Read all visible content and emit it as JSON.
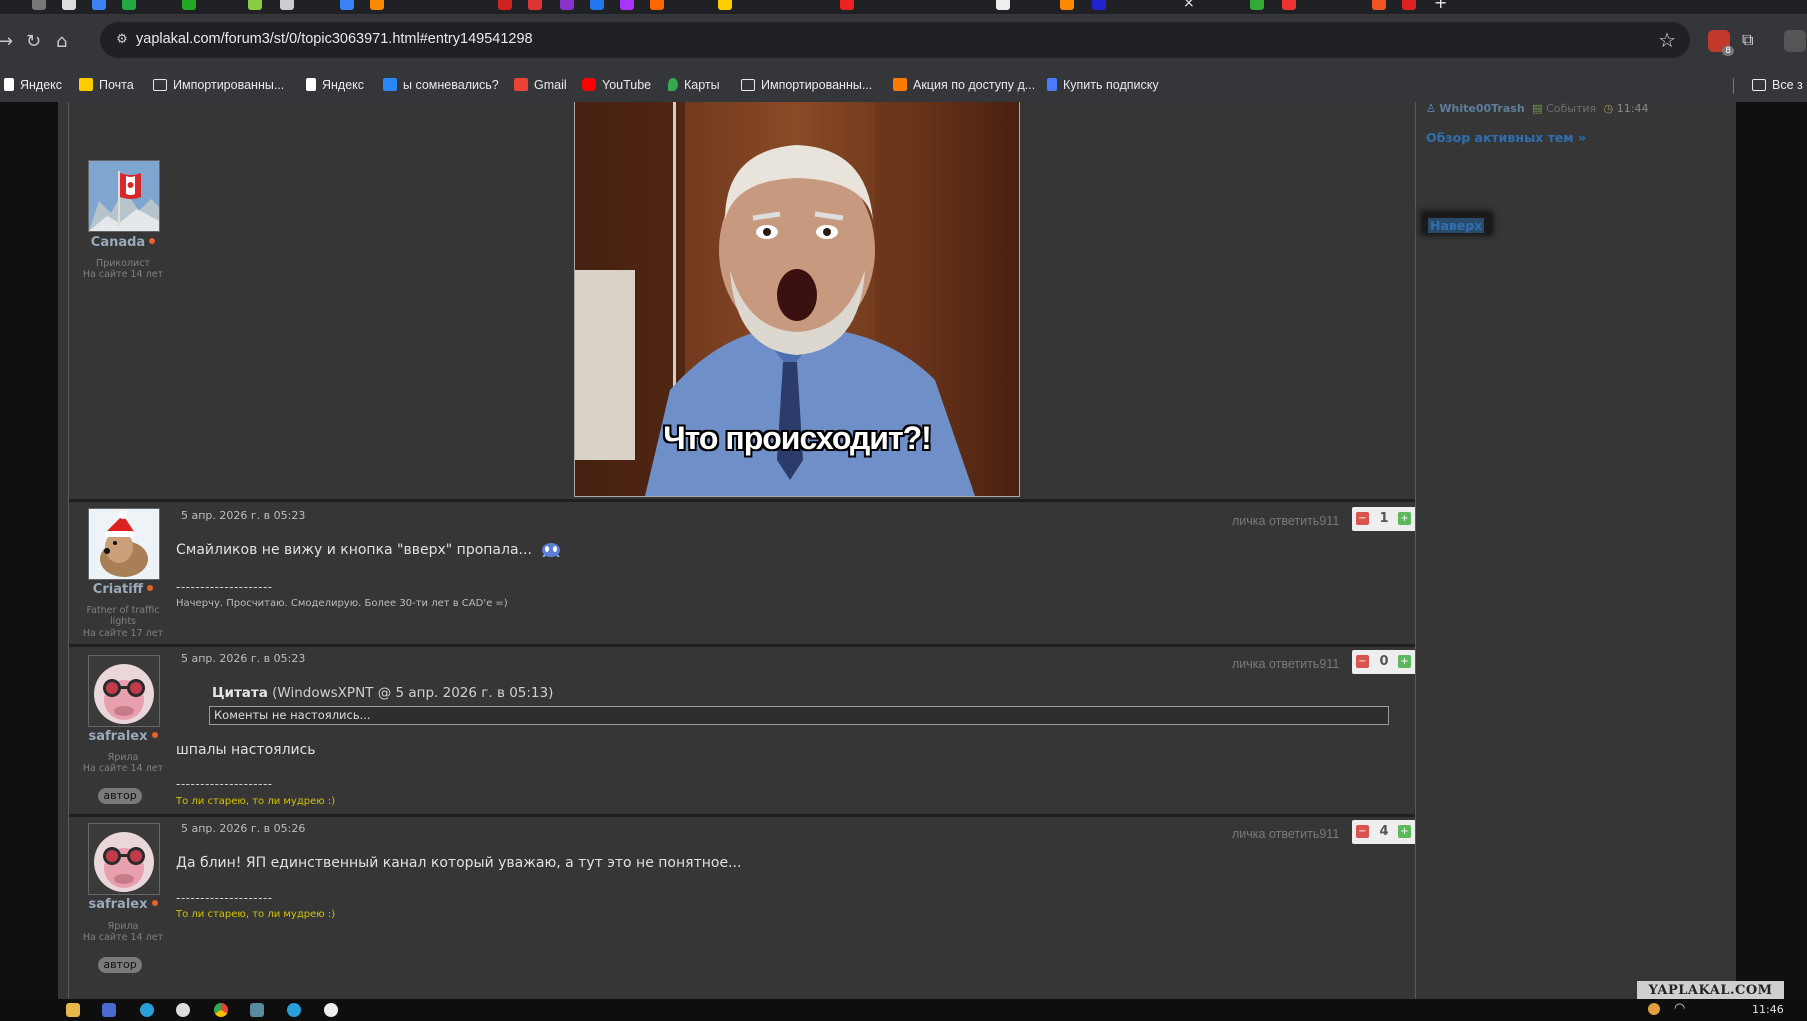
{
  "browser": {
    "url": "yaplakal.com/forum3/st/0/topic3063971.html#entry149541298",
    "extension_badge": "8",
    "bookmarks": [
      {
        "label": "Яндекс",
        "icon": "yandex-icon",
        "color": "#ffffff"
      },
      {
        "label": "Почта",
        "icon": "mail-icon",
        "color": "#ffcc00"
      },
      {
        "label": "Импортированны...",
        "icon": "folder-icon",
        "color": "#e8eaed"
      },
      {
        "label": "Яндекс",
        "icon": "yandex-icon",
        "color": "#ffffff"
      },
      {
        "label": "ы сомневались?",
        "icon": "vk-icon",
        "color": "#2787f5"
      },
      {
        "label": "Gmail",
        "icon": "gmail-icon",
        "color": "#ea4335"
      },
      {
        "label": "YouTube",
        "icon": "youtube-icon",
        "color": "#ff0000"
      },
      {
        "label": "Карты",
        "icon": "maps-icon",
        "color": "#34a853"
      },
      {
        "label": "Импортированны...",
        "icon": "folder-icon",
        "color": "#e8eaed"
      },
      {
        "label": "Акция по доступу д...",
        "icon": "promo-icon",
        "color": "#ff7a00"
      },
      {
        "label": "Купить подписку",
        "icon": "subscription-icon",
        "color": "#4a7bff"
      }
    ],
    "bookmarks_overflow": "Все з"
  },
  "sidebar": {
    "active_user": "White00Trash",
    "events_label": "События",
    "time": "11:44",
    "active_topics_link": "Обзор активных тем »",
    "top_button": "Наверх"
  },
  "first_post": {
    "user": "Canada",
    "rank": "Приколист",
    "tenure": "На сайте 14 лет",
    "image_caption": "Что происходит?!"
  },
  "posts": [
    {
      "user": "Criatiff",
      "rank": "Father of traffic lights",
      "tenure": "На сайте 17 лет",
      "date": "5 апр. 2026 г. в 05:23",
      "actions": "личка ответить911",
      "rating": "1",
      "text": "Смайликов не вижу и кнопка \"вверх\" пропала...",
      "separator": "--------------------",
      "signature": "Начерчу. Просчитаю. Смоделирую. Более 30-ти лет в CAD'е =)",
      "signature_color": "#bdbdbd"
    },
    {
      "user": "safralex",
      "rank": "Ярила",
      "tenure": "На сайте 14 лет",
      "badge": "автор",
      "date": "5 апр. 2026 г. в 05:23",
      "actions": "личка ответить911",
      "rating": "0",
      "quote_label": "Цитата",
      "quote_source": " (WindowsXPNT @ 5 апр. 2026 г. в 05:13)",
      "quote_text": "Коменты не настоялись...",
      "text": "шпалы настоялись",
      "separator": "--------------------",
      "signature": "То ли старею, то ли мудрею :)",
      "signature_color": "#d4c200"
    },
    {
      "user": "safralex",
      "rank": "Ярила",
      "tenure": "На сайте 14 лет",
      "badge": "автор",
      "date": "5 апр. 2026 г. в 05:26",
      "actions": "личка ответить911",
      "rating": "4",
      "text": "Да блин! ЯП единственный канал который уважаю, а тут это не понятное...",
      "separator": "--------------------",
      "signature": "То ли старею, то ли мудрею :)",
      "signature_color": "#d4c200"
    }
  ],
  "watermark": "YAPLAKAL.COM",
  "taskbar": {
    "time": "11:46"
  }
}
